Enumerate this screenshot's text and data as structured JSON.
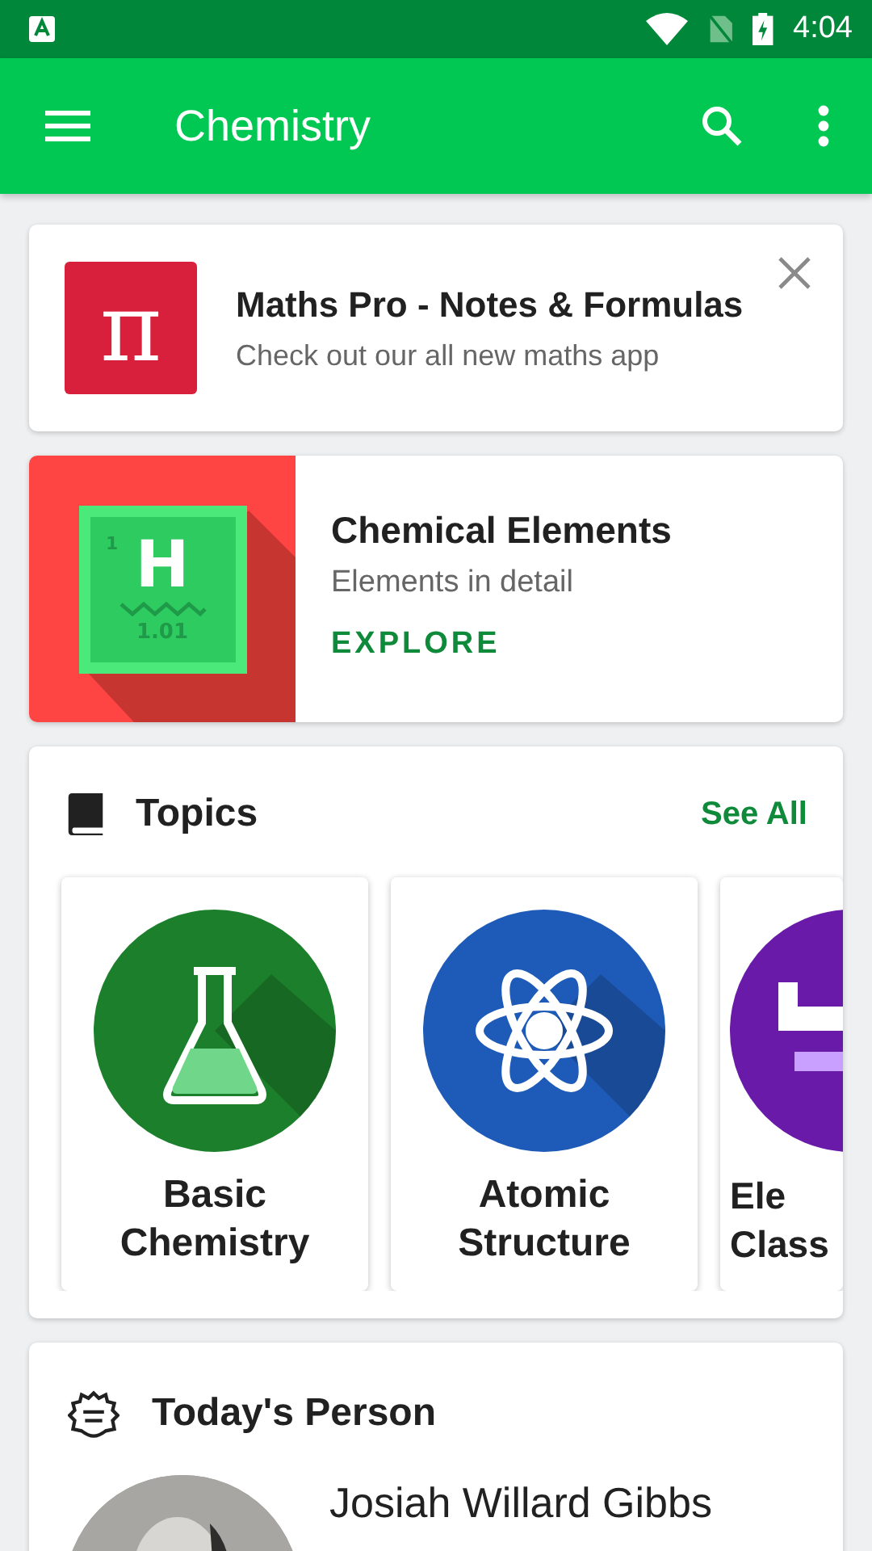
{
  "status_bar": {
    "time": "4:04"
  },
  "toolbar": {
    "title": "Chemistry"
  },
  "promo": {
    "title": "Maths Pro - Notes & Formulas",
    "subtitle": "Check out our all new maths app",
    "icon_text": "π"
  },
  "elements_card": {
    "title": "Chemical Elements",
    "subtitle": "Elements in detail",
    "action": "EXPLORE",
    "tile_symbol": "H",
    "tile_number": "1",
    "tile_mass": "1.01"
  },
  "topics": {
    "title": "Topics",
    "see_all": "See All",
    "items": [
      {
        "title": "Basic Chemistry",
        "color": "#1b7f2b",
        "kind": "flask"
      },
      {
        "title": "Atomic Structure",
        "color": "#1e5bb8",
        "kind": "atom"
      },
      {
        "title": "Ele Class",
        "color": "#6a1aa8",
        "kind": "partial"
      }
    ]
  },
  "person": {
    "title": "Today's Person",
    "name": "Josiah Willard Gibbs"
  }
}
